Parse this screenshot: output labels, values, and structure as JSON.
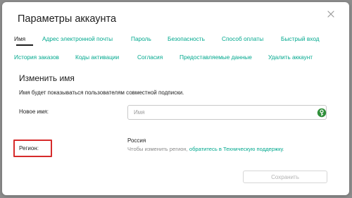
{
  "dialog": {
    "title": "Параметры аккаунта",
    "close_icon": "close-icon"
  },
  "tabs_row1": [
    {
      "label": "Имя",
      "active": true
    },
    {
      "label": "Адрес электронной почты"
    },
    {
      "label": "Пароль"
    },
    {
      "label": "Безопасность"
    },
    {
      "label": "Способ оплаты"
    },
    {
      "label": "Быстрый вход"
    }
  ],
  "tabs_row2": [
    {
      "label": "История заказов"
    },
    {
      "label": "Коды активации"
    },
    {
      "label": "Согласия"
    },
    {
      "label": "Предоставляемые данные"
    },
    {
      "label": "Удалить аккаунт"
    }
  ],
  "section": {
    "title": "Изменить имя",
    "subtitle": "Имя будет показываться пользователям совместной подписки."
  },
  "new_name": {
    "label": "Новое имя:",
    "placeholder": "Имя",
    "value": "",
    "icon": "key-icon"
  },
  "region": {
    "label": "Регион:",
    "value": "Россия",
    "hint_prefix": "Чтобы изменить регион, ",
    "hint_link": "обратитесь в Техническую поддержку",
    "hint_suffix": "."
  },
  "save_label": "Сохранить",
  "colors": {
    "accent": "#00a88e",
    "highlight_border": "#d62b2b",
    "key_icon": "#2f8f3a"
  }
}
